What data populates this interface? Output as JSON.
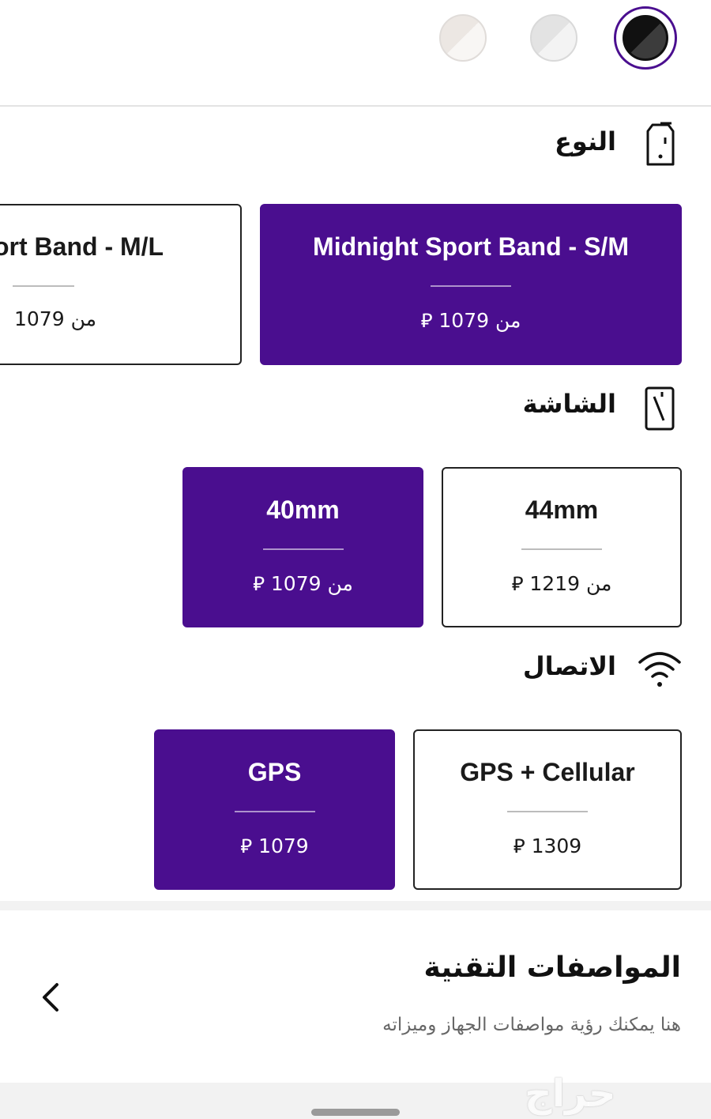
{
  "colors": {
    "accent": "#4a0e8f",
    "selected_swatch": "midnight",
    "swatches": [
      "midnight",
      "silver",
      "starlight"
    ]
  },
  "sections": {
    "type": {
      "title": "النوع",
      "icon": "watch-band-icon"
    },
    "screen": {
      "title": "الشاشة",
      "icon": "watch-screen-icon"
    },
    "connection": {
      "title": "الاتصال",
      "icon": "wifi-icon"
    }
  },
  "type_options": [
    {
      "label": "ort Band - M/L",
      "price": "من 1079",
      "selected": false
    },
    {
      "label": "Midnight Sport Band - S/M",
      "price": "من 1079 ⃁",
      "selected": true
    }
  ],
  "screen_options": [
    {
      "label": "40mm",
      "price": "من 1079 ⃁",
      "selected": true
    },
    {
      "label": "44mm",
      "price": "من 1219 ⃁",
      "selected": false
    }
  ],
  "connection_options": [
    {
      "label": "GPS",
      "price": "1079 ⃁",
      "selected": true
    },
    {
      "label": "GPS + Cellular",
      "price": "1309 ⃁",
      "selected": false
    }
  ],
  "specs": {
    "title": "المواصفات التقنية",
    "subtitle": "هنا يمكنك رؤية مواصفات الجهاز وميزاته"
  },
  "watermark": "حراج"
}
